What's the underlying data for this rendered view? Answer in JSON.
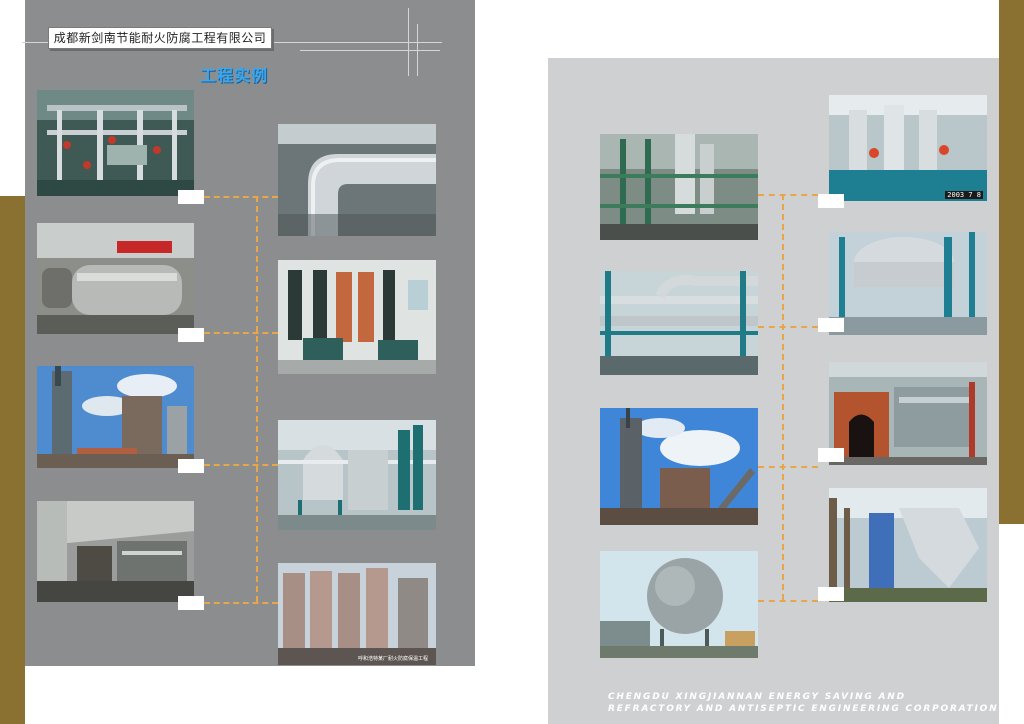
{
  "company_name": "成都新剑南节能耐火防腐工程有限公司",
  "section_title": "工程实例",
  "footer": {
    "line1": "CHENGDU XINGJIANNAN ENERGY SAVING AND",
    "line2": "REFRACTORY AND ANTISEPTIC ENGINEERING CORPORATION LIMITED"
  },
  "photo_captions": {
    "tower_project": "呼和浩特某厂耐火防腐保温工程",
    "date_stamp": "2003 7 8"
  },
  "colors": {
    "left_panel": "#8c8d8f",
    "right_panel": "#cfd0d2",
    "gold_accent": "#8a7132",
    "connector": "#e8a64a",
    "title_blue": "#3aa7ee"
  },
  "photos": [
    {
      "id": "L1",
      "subject": "piping-valves"
    },
    {
      "id": "L2",
      "subject": "tank-banner"
    },
    {
      "id": "L3",
      "subject": "plant-sky"
    },
    {
      "id": "L4",
      "subject": "factory-hall"
    },
    {
      "id": "L5",
      "subject": "insulated-elbow"
    },
    {
      "id": "L6",
      "subject": "pump-room"
    },
    {
      "id": "L7",
      "subject": "spherical-tanks"
    },
    {
      "id": "L8",
      "subject": "silo-towers"
    },
    {
      "id": "R1",
      "subject": "steel-structure"
    },
    {
      "id": "R2",
      "subject": "pipe-rack"
    },
    {
      "id": "R3",
      "subject": "tower-sky"
    },
    {
      "id": "R4",
      "subject": "gas-sphere"
    },
    {
      "id": "R5",
      "subject": "insulated-columns"
    },
    {
      "id": "R6",
      "subject": "insulated-tank"
    },
    {
      "id": "R7",
      "subject": "brick-furnace"
    },
    {
      "id": "R8",
      "subject": "cyclone-ducts"
    }
  ]
}
